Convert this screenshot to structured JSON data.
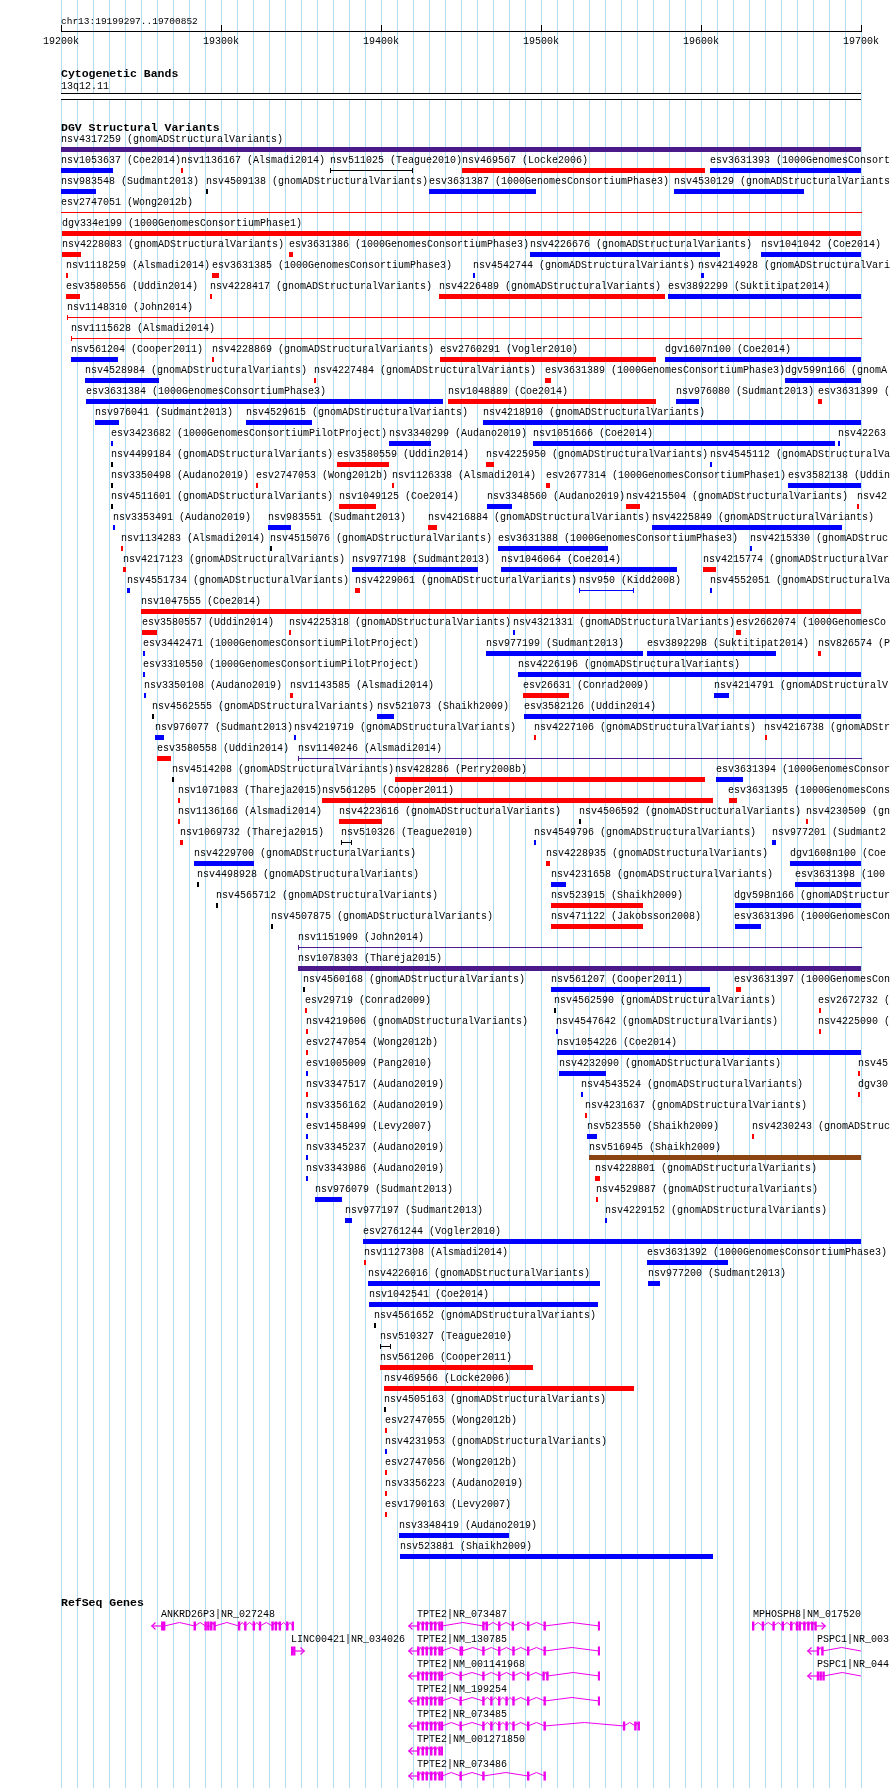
{
  "ruler": {
    "position": "chr13:19199297..19700852",
    "ticks": [
      "19200k",
      "19300k",
      "19400k",
      "19500k",
      "19600k",
      "19700k"
    ]
  },
  "cytoband_track": {
    "title": "Cytogenetic Bands",
    "bands": [
      {
        "name": "13q12.11"
      }
    ]
  },
  "dgv_track": {
    "title": "DGV Structural Variants",
    "rows": [
      [
        {
          "label": "nsv4317259 (gnomADStructuralVariants)",
          "color": "#4b1a8a",
          "kind": "bar"
        }
      ],
      [
        {
          "label": "nsv1053637 (Coe2014)",
          "color": "#0000ff",
          "kind": "bar"
        },
        {
          "label": "nsv1136167 (Alsmadi2014)",
          "color": "#ff0000",
          "kind": "bar"
        },
        {
          "label": "nsv511025 (Teague2010)",
          "color": "#000000",
          "kind": "line"
        },
        {
          "label": "nsv469567 (Locke2006)",
          "color": "#ff0000",
          "kind": "bar"
        },
        {
          "label": "esv3631393 (1000GenomesConsort",
          "color": "#0000ff",
          "kind": "bar"
        }
      ],
      [
        {
          "label": "nsv983548 (Sudmant2013)",
          "color": "#0000ff",
          "kind": "bar"
        },
        {
          "label": "nsv4509138 (gnomADStructuralVariants)",
          "color": "#000000",
          "kind": "bar"
        },
        {
          "label": "esv3631387 (1000GenomesConsortiumPhase3)",
          "color": "#0000ff",
          "kind": "bar"
        },
        {
          "label": "nsv4530129 (gnomADStructuralVariants",
          "color": "#0000ff",
          "kind": "bar"
        }
      ],
      [
        {
          "label": "esv2747051 (Wong2012b)",
          "color": "#ff0000",
          "kind": "line"
        }
      ],
      [
        {
          "label": "dgv334e199 (1000GenomesConsortiumPhase1)",
          "color": "#ff0000",
          "kind": "bar"
        }
      ],
      [
        {
          "label": "nsv4228083 (gnomADStructuralVariants)",
          "color": "#ff0000",
          "kind": "bar"
        },
        {
          "label": "esv3631386 (1000GenomesConsortiumPhase3)",
          "color": "#ff0000",
          "kind": "bar"
        },
        {
          "label": "nsv4226676 (gnomADStructuralVariants)",
          "color": "#0000ff",
          "kind": "bar"
        },
        {
          "label": "nsv1041042 (Coe2014)",
          "color": "#0000ff",
          "kind": "bar"
        }
      ],
      [
        {
          "label": "nsv1118259 (Alsmadi2014)",
          "color": "#ff0000",
          "kind": "bar"
        },
        {
          "label": "esv3631385 (1000GenomesConsortiumPhase3)",
          "color": "#ff0000",
          "kind": "bar"
        },
        {
          "label": "nsv4542744 (gnomADStructuralVariants)",
          "color": "#0000ff",
          "kind": "bar"
        },
        {
          "label": "nsv4214928 (gnomADStructuralVari",
          "color": "#0000ff",
          "kind": "bar"
        }
      ],
      [
        {
          "label": "esv3580556 (Uddin2014)",
          "color": "#ff0000",
          "kind": "bar"
        },
        {
          "label": "nsv4228417 (gnomADStructuralVariants)",
          "color": "#ff0000",
          "kind": "bar"
        },
        {
          "label": "nsv4226489 (gnomADStructuralVariants)",
          "color": "#ff0000",
          "kind": "bar"
        },
        {
          "label": "esv3892299 (Suktitipat2014)",
          "color": "#0000ff",
          "kind": "bar"
        }
      ],
      [
        {
          "label": "nsv1148310 (John2014)",
          "color": "#ff0000",
          "kind": "line"
        }
      ],
      [
        {
          "label": "nsv1115628 (Alsmadi2014)",
          "color": "#ff0000",
          "kind": "line"
        }
      ],
      [
        {
          "label": "nsv561204 (Cooper2011)",
          "color": "#0000ff",
          "kind": "bar"
        },
        {
          "label": "nsv4228869 (gnomADStructuralVariants)",
          "color": "#ff0000",
          "kind": "bar"
        },
        {
          "label": "esv2760291 (Vogler2010)",
          "color": "#ff0000",
          "kind": "bar"
        },
        {
          "label": "dgv1607n100 (Coe2014)",
          "color": "#0000ff",
          "kind": "bar"
        }
      ],
      [
        {
          "label": "nsv4528984 (gnomADStructuralVariants)",
          "color": "#0000ff",
          "kind": "bar"
        },
        {
          "label": "nsv4227484 (gnomADStructuralVariants)",
          "color": "#ff0000",
          "kind": "bar"
        },
        {
          "label": "esv3631389 (1000GenomesConsortiumPhase3)",
          "color": "#ff0000",
          "kind": "bar"
        },
        {
          "label": "dgv599n166 (gnomA",
          "color": "#0000ff",
          "kind": "bar"
        }
      ],
      [
        {
          "label": "esv3631384 (1000GenomesConsortiumPhase3)",
          "color": "#0000ff",
          "kind": "bar"
        },
        {
          "label": "nsv1048889 (Coe2014)",
          "color": "#ff0000",
          "kind": "bar"
        },
        {
          "label": "nsv976080 (Sudmant2013)",
          "color": "#0000ff",
          "kind": "bar"
        },
        {
          "label": "esv3631399 (",
          "color": "#ff0000",
          "kind": "bar"
        }
      ],
      [
        {
          "label": "nsv976041 (Sudmant2013)",
          "color": "#0000ff",
          "kind": "bar"
        },
        {
          "label": "nsv4529615 (gnomADStructuralVariants)",
          "color": "#0000ff",
          "kind": "bar"
        },
        {
          "label": "nsv4218910 (gnomADStructuralVariants)",
          "color": "#0000ff",
          "kind": "bar"
        }
      ],
      [
        {
          "label": "esv3423682 (1000GenomesConsortiumPilotProject)",
          "color": "#0000ff",
          "kind": "bar"
        },
        {
          "label": "nsv3340299 (Audano2019)",
          "color": "#0000ff",
          "kind": "bar"
        },
        {
          "label": "nsv1051666 (Coe2014)",
          "color": "#0000ff",
          "kind": "bar"
        },
        {
          "label": "nsv42263",
          "color": "#0000ff",
          "kind": "bar"
        }
      ],
      [
        {
          "label": "nsv4499184 (gnomADStructuralVariants)",
          "color": "#000000",
          "kind": "bar"
        },
        {
          "label": "esv3580559 (Uddin2014)",
          "color": "#ff0000",
          "kind": "bar"
        },
        {
          "label": "nsv4225950 (gnomADStructuralVariants)",
          "color": "#ff0000",
          "kind": "bar"
        },
        {
          "label": "nsv4545112 (gnomADStructuralVa",
          "color": "#0000ff",
          "kind": "bar"
        }
      ],
      [
        {
          "label": "nsv3350498 (Audano2019)",
          "color": "#000000",
          "kind": "bar"
        },
        {
          "label": "esv2747053 (Wong2012b)",
          "color": "#ff0000",
          "kind": "bar"
        },
        {
          "label": "nsv1126338 (Alsmadi2014)",
          "color": "#ff0000",
          "kind": "bar"
        },
        {
          "label": "esv2677314 (1000GenomesConsortiumPhase1)",
          "color": "#ff0000",
          "kind": "bar"
        },
        {
          "label": "esv3582138 (Uddin",
          "color": "#0000ff",
          "kind": "bar"
        }
      ],
      [
        {
          "label": "nsv4511601 (gnomADStructuralVariants)",
          "color": "#000000",
          "kind": "bar"
        },
        {
          "label": "nsv1049125 (Coe2014)",
          "color": "#ff0000",
          "kind": "bar"
        },
        {
          "label": "nsv3348560 (Audano2019)",
          "color": "#0000ff",
          "kind": "bar"
        },
        {
          "label": "nsv4215504 (gnomADStructuralVariants)",
          "color": "#ff0000",
          "kind": "bar"
        },
        {
          "label": "nsv42",
          "color": "#ff0000",
          "kind": "bar"
        }
      ],
      [
        {
          "label": "nsv3353491 (Audano2019)",
          "color": "#0000ff",
          "kind": "bar"
        },
        {
          "label": "nsv983551 (Sudmant2013)",
          "color": "#0000ff",
          "kind": "bar"
        },
        {
          "label": "nsv4216884 (gnomADStructuralVariants)",
          "color": "#ff0000",
          "kind": "bar"
        },
        {
          "label": "nsv4225849 (gnomADStructuralVariants)",
          "color": "#0000ff",
          "kind": "bar"
        }
      ],
      [
        {
          "label": "nsv1134283 (Alsmadi2014)",
          "color": "#ff0000",
          "kind": "bar"
        },
        {
          "label": "nsv4515076 (gnomADStructuralVariants)",
          "color": "#000000",
          "kind": "bar"
        },
        {
          "label": "esv3631388 (1000GenomesConsortiumPhase3)",
          "color": "#0000ff",
          "kind": "bar"
        },
        {
          "label": "nsv4215330 (gnomADStruc",
          "color": "#0000ff",
          "kind": "bar"
        }
      ],
      [
        {
          "label": "nsv4217123 (gnomADStructuralVariants)",
          "color": "#ff0000",
          "kind": "bar"
        },
        {
          "label": "nsv977198 (Sudmant2013)",
          "color": "#0000ff",
          "kind": "bar"
        },
        {
          "label": "nsv1046064 (Coe2014)",
          "color": "#0000ff",
          "kind": "bar"
        },
        {
          "label": "nsv4215774 (gnomADStructuralVar",
          "color": "#ff0000",
          "kind": "bar"
        }
      ],
      [
        {
          "label": "nsv4551734 (gnomADStructuralVariants)",
          "color": "#0000ff",
          "kind": "bar"
        },
        {
          "label": "nsv4229061 (gnomADStructuralVariants)",
          "color": "#ff0000",
          "kind": "bar"
        },
        {
          "label": "nsv950 (Kidd2008)",
          "color": "#0000ff",
          "kind": "line"
        },
        {
          "label": "nsv4552051 (gnomADStructuralVa",
          "color": "#0000ff",
          "kind": "bar"
        }
      ],
      [
        {
          "label": "nsv1047555 (Coe2014)",
          "color": "#ff0000",
          "kind": "bar"
        }
      ],
      [
        {
          "label": "esv3580557 (Uddin2014)",
          "color": "#ff0000",
          "kind": "bar"
        },
        {
          "label": "nsv4225318 (gnomADStructuralVariants)",
          "color": "#ff0000",
          "kind": "bar"
        },
        {
          "label": "nsv4321331 (gnomADStructuralVariants)",
          "color": "#0000ff",
          "kind": "bar"
        },
        {
          "label": "esv2662074 (1000GenomesCo",
          "color": "#ff0000",
          "kind": "bar"
        }
      ],
      [
        {
          "label": "esv3442471 (1000GenomesConsortiumPilotProject)",
          "color": "#0000ff",
          "kind": "bar"
        },
        {
          "label": "nsv977199 (Sudmant2013)",
          "color": "#0000ff",
          "kind": "bar"
        },
        {
          "label": "esv3892298 (Suktitipat2014)",
          "color": "#0000ff",
          "kind": "bar"
        },
        {
          "label": "nsv826574 (P",
          "color": "#ff0000",
          "kind": "bar"
        }
      ],
      [
        {
          "label": "esv3310550 (1000GenomesConsortiumPilotProject)",
          "color": "#0000ff",
          "kind": "bar"
        },
        {
          "label": "nsv4226196 (gnomADStructuralVariants)",
          "color": "#0000ff",
          "kind": "bar"
        }
      ],
      [
        {
          "label": "nsv3350108 (Audano2019)",
          "color": "#0000ff",
          "kind": "bar"
        },
        {
          "label": "nsv1143585 (Alsmadi2014)",
          "color": "#ff0000",
          "kind": "bar"
        },
        {
          "label": "esv26631 (Conrad2009)",
          "color": "#ff0000",
          "kind": "bar"
        },
        {
          "label": "nsv4214791 (gnomADStructuralV",
          "color": "#0000ff",
          "kind": "bar"
        }
      ],
      [
        {
          "label": "nsv4562555 (gnomADStructuralVariants)",
          "color": "#000000",
          "kind": "bar"
        },
        {
          "label": "nsv521073 (Shaikh2009)",
          "color": "#0000ff",
          "kind": "bar"
        },
        {
          "label": "esv3582126 (Uddin2014)",
          "color": "#0000ff",
          "kind": "bar"
        }
      ],
      [
        {
          "label": "nsv976077 (Sudmant2013)",
          "color": "#0000ff",
          "kind": "bar"
        },
        {
          "label": "nsv4219719 (gnomADStructuralVariants)",
          "color": "#0000ff",
          "kind": "bar"
        },
        {
          "label": "nsv4227106 (gnomADStructuralVariants)",
          "color": "#ff0000",
          "kind": "bar"
        },
        {
          "label": "nsv4216738 (gnomADStr",
          "color": "#ff0000",
          "kind": "bar"
        }
      ],
      [
        {
          "label": "esv3580558 (Uddin2014)",
          "color": "#ff0000",
          "kind": "bar"
        },
        {
          "label": "nsv1140246 (Alsmadi2014)",
          "color": "#4b1a8a",
          "kind": "line"
        }
      ],
      [
        {
          "label": "nsv4514208 (gnomADStructuralVariants)",
          "color": "#000000",
          "kind": "bar"
        },
        {
          "label": "nsv428286 (Perry2008b)",
          "color": "#ff0000",
          "kind": "bar"
        },
        {
          "label": "esv3631394 (1000GenomesConsor",
          "color": "#0000ff",
          "kind": "bar"
        }
      ],
      [
        {
          "label": "nsv1071083 (Thareja2015)",
          "color": "#ff0000",
          "kind": "bar"
        },
        {
          "label": "nsv561205 (Cooper2011)",
          "color": "#ff0000",
          "kind": "bar"
        },
        {
          "label": "esv3631395 (1000GenomesCons",
          "color": "#ff0000",
          "kind": "bar"
        }
      ],
      [
        {
          "label": "nsv1136166 (Alsmadi2014)",
          "color": "#ff0000",
          "kind": "bar"
        },
        {
          "label": "nsv4223616 (gnomADStructuralVariants)",
          "color": "#ff0000",
          "kind": "bar"
        },
        {
          "label": "nsv4506592 (gnomADStructuralVariants)",
          "color": "#000000",
          "kind": "bar"
        },
        {
          "label": "nsv4230509 (gn",
          "color": "#ff0000",
          "kind": "bar"
        }
      ],
      [
        {
          "label": "nsv1069732 (Thareja2015)",
          "color": "#ff0000",
          "kind": "bar"
        },
        {
          "label": "nsv510326 (Teague2010)",
          "color": "#000000",
          "kind": "line"
        },
        {
          "label": "nsv4549796 (gnomADStructuralVariants)",
          "color": "#0000ff",
          "kind": "bar"
        },
        {
          "label": "nsv977201 (Sudmant2",
          "color": "#0000ff",
          "kind": "bar"
        }
      ],
      [
        {
          "label": "nsv4229700 (gnomADStructuralVariants)",
          "color": "#0000ff",
          "kind": "bar"
        },
        {
          "label": "nsv4228935 (gnomADStructuralVariants)",
          "color": "#ff0000",
          "kind": "bar"
        },
        {
          "label": "dgv1608n100 (Coe",
          "color": "#0000ff",
          "kind": "bar"
        }
      ],
      [
        {
          "label": "nsv4498928 (gnomADStructuralVariants)",
          "color": "#000000",
          "kind": "bar"
        },
        {
          "label": "nsv4231658 (gnomADStructuralVariants)",
          "color": "#0000ff",
          "kind": "bar"
        },
        {
          "label": "esv3631398 (100",
          "color": "#0000ff",
          "kind": "bar"
        }
      ],
      [
        {
          "label": "nsv4565712 (gnomADStructuralVariants)",
          "color": "#000000",
          "kind": "bar"
        },
        {
          "label": "nsv523915 (Shaikh2009)",
          "color": "#ff0000",
          "kind": "bar"
        },
        {
          "label": "dgv598n166 (gnomADStructur",
          "color": "#0000ff",
          "kind": "bar"
        }
      ],
      [
        {
          "label": "nsv4507875 (gnomADStructuralVariants)",
          "color": "#000000",
          "kind": "bar"
        },
        {
          "label": "nsv471122 (Jakobsson2008)",
          "color": "#ff0000",
          "kind": "bar"
        },
        {
          "label": "esv3631396 (1000GenomesCon",
          "color": "#0000ff",
          "kind": "bar"
        }
      ],
      [
        {
          "label": "nsv1151909 (John2014)",
          "color": "#4b1a8a",
          "kind": "line"
        }
      ],
      [
        {
          "label": "nsv1078303 (Thareja2015)",
          "color": "#4b1a8a",
          "kind": "bar"
        }
      ],
      [
        {
          "label": "nsv4560168 (gnomADStructuralVariants)",
          "color": "#000000",
          "kind": "bar"
        },
        {
          "label": "nsv561207 (Cooper2011)",
          "color": "#0000ff",
          "kind": "bar"
        },
        {
          "label": "esv3631397 (1000GenomesCon",
          "color": "#ff0000",
          "kind": "bar"
        }
      ],
      [
        {
          "label": "esv29719 (Conrad2009)",
          "color": "#ff0000",
          "kind": "bar"
        },
        {
          "label": "nsv4562590 (gnomADStructuralVariants)",
          "color": "#000000",
          "kind": "bar"
        },
        {
          "label": "esv2672732 (",
          "color": "#ff0000",
          "kind": "bar"
        }
      ],
      [
        {
          "label": "nsv4219606 (gnomADStructuralVariants)",
          "color": "#ff0000",
          "kind": "bar"
        },
        {
          "label": "nsv4547642 (gnomADStructuralVariants)",
          "color": "#0000ff",
          "kind": "bar"
        },
        {
          "label": "nsv4225090 (",
          "color": "#ff0000",
          "kind": "bar"
        }
      ],
      [
        {
          "label": "esv2747054 (Wong2012b)",
          "color": "#ff0000",
          "kind": "bar"
        },
        {
          "label": "nsv1054226 (Coe2014)",
          "color": "#0000ff",
          "kind": "bar"
        }
      ],
      [
        {
          "label": "esv1005009 (Pang2010)",
          "color": "#0000ff",
          "kind": "bar"
        },
        {
          "label": "nsv4232090 (gnomADStructuralVariants)",
          "color": "#0000ff",
          "kind": "bar"
        },
        {
          "label": "nsv45",
          "color": "#ff0000",
          "kind": "bar"
        }
      ],
      [
        {
          "label": "nsv3347517 (Audano2019)",
          "color": "#ff0000",
          "kind": "bar"
        },
        {
          "label": "nsv4543524 (gnomADStructuralVariants)",
          "color": "#0000ff",
          "kind": "bar"
        },
        {
          "label": "dgv30",
          "color": "#ff0000",
          "kind": "bar"
        }
      ],
      [
        {
          "label": "nsv3356162 (Audano2019)",
          "color": "#0000ff",
          "kind": "bar"
        },
        {
          "label": "nsv4231637 (gnomADStructuralVariants)",
          "color": "#ff0000",
          "kind": "bar"
        }
      ],
      [
        {
          "label": "esv1458499 (Levy2007)",
          "color": "#0000ff",
          "kind": "bar"
        },
        {
          "label": "nsv523550 (Shaikh2009)",
          "color": "#0000ff",
          "kind": "bar"
        },
        {
          "label": "nsv4230243 (gnomADStruc",
          "color": "#ff0000",
          "kind": "bar"
        }
      ],
      [
        {
          "label": "nsv3345237 (Audano2019)",
          "color": "#0000ff",
          "kind": "bar"
        },
        {
          "label": "nsv516945 (Shaikh2009)",
          "color": "#8b4513",
          "kind": "bar"
        }
      ],
      [
        {
          "label": "nsv3343986 (Audano2019)",
          "color": "#0000ff",
          "kind": "bar"
        },
        {
          "label": "nsv4228801 (gnomADStructuralVariants)",
          "color": "#ff0000",
          "kind": "bar"
        }
      ],
      [
        {
          "label": "nsv976079 (Sudmant2013)",
          "color": "#0000ff",
          "kind": "bar"
        },
        {
          "label": "nsv4529887 (gnomADStructuralVariants)",
          "color": "#ff0000",
          "kind": "bar"
        }
      ],
      [
        {
          "label": "nsv977197 (Sudmant2013)",
          "color": "#0000ff",
          "kind": "bar"
        },
        {
          "label": "nsv4229152 (gnomADStructuralVariants)",
          "color": "#0000ff",
          "kind": "bar"
        }
      ],
      [
        {
          "label": "esv2761244 (Vogler2010)",
          "color": "#0000ff",
          "kind": "bar"
        }
      ],
      [
        {
          "label": "nsv1127308 (Alsmadi2014)",
          "color": "#ff0000",
          "kind": "bar"
        },
        {
          "label": "esv3631392 (1000GenomesConsortiumPhase3)",
          "color": "#0000ff",
          "kind": "bar"
        }
      ],
      [
        {
          "label": "nsv4226016 (gnomADStructuralVariants)",
          "color": "#0000ff",
          "kind": "bar"
        },
        {
          "label": "nsv977200 (Sudmant2013)",
          "color": "#0000ff",
          "kind": "bar"
        }
      ],
      [
        {
          "label": "nsv1042541 (Coe2014)",
          "color": "#0000ff",
          "kind": "bar"
        }
      ],
      [
        {
          "label": "nsv4561652 (gnomADStructuralVariants)",
          "color": "#000000",
          "kind": "bar"
        }
      ],
      [
        {
          "label": "nsv510327 (Teague2010)",
          "color": "#000000",
          "kind": "line"
        }
      ],
      [
        {
          "label": "nsv561206 (Cooper2011)",
          "color": "#ff0000",
          "kind": "bar"
        }
      ],
      [
        {
          "label": "nsv469566 (Locke2006)",
          "color": "#ff0000",
          "kind": "bar"
        }
      ],
      [
        {
          "label": "nsv4505163 (gnomADStructuralVariants)",
          "color": "#000000",
          "kind": "bar"
        }
      ],
      [
        {
          "label": "esv2747055 (Wong2012b)",
          "color": "#ff0000",
          "kind": "bar"
        }
      ],
      [
        {
          "label": "nsv4231953 (gnomADStructuralVariants)",
          "color": "#0000ff",
          "kind": "bar"
        }
      ],
      [
        {
          "label": "esv2747056 (Wong2012b)",
          "color": "#ff0000",
          "kind": "bar"
        }
      ],
      [
        {
          "label": "nsv3356223 (Audano2019)",
          "color": "#ff0000",
          "kind": "bar"
        }
      ],
      [
        {
          "label": "esv1790163 (Levy2007)",
          "color": "#ff0000",
          "kind": "bar"
        }
      ],
      [
        {
          "label": "nsv3348419 (Audano2019)",
          "color": "#0000ff",
          "kind": "bar"
        }
      ],
      [
        {
          "label": "nsv523881 (Shaikh2009)",
          "color": "#0000ff",
          "kind": "bar"
        }
      ]
    ]
  },
  "gene_track": {
    "title": "RefSeq Genes",
    "genes": [
      {
        "label": "ANKRD26P3|NR_027248",
        "reverse_strand": true
      },
      {
        "label": "TPTE2|NR_073487",
        "reverse_strand": true
      },
      {
        "label": "MPHOSPH8|NM_017520",
        "reverse_strand": false
      },
      {
        "label": "LINC00421|NR_034026",
        "reverse_strand": false
      },
      {
        "label": "TPTE2|NM_130785",
        "reverse_strand": true
      },
      {
        "label": "PSPC1|NR_003",
        "reverse_strand": true
      },
      {
        "label": "TPTE2|NM_001141968",
        "reverse_strand": true
      },
      {
        "label": "PSPC1|NR_044",
        "reverse_strand": true
      },
      {
        "label": "TPTE2|NM_199254",
        "reverse_strand": true
      },
      {
        "label": "TPTE2|NR_073485",
        "reverse_strand": true
      },
      {
        "label": "TPTE2|NM_001271850",
        "reverse_strand": true
      },
      {
        "label": "TPTE2|NR_073486",
        "reverse_strand": true
      }
    ]
  }
}
